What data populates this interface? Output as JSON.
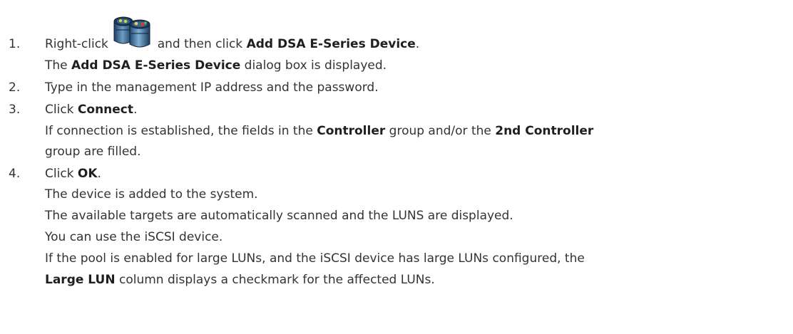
{
  "steps": [
    {
      "number": "1.",
      "lines": [
        {
          "pre": "Right-click",
          "icon": "storage-device-icon",
          "post": "and then click",
          "bold": "Add DSA E-Series Device",
          "end": "."
        },
        {
          "pre": "The",
          "bold": "Add DSA E-Series Device",
          "post": "dialog box is displayed."
        }
      ]
    },
    {
      "number": "2.",
      "lines": [
        {
          "text": "Type in the management IP address and the password."
        }
      ]
    },
    {
      "number": "3.",
      "lines": [
        {
          "pre": "Click",
          "bold": "Connect",
          "end": "."
        },
        {
          "pre": "If connection is established, the fields in the",
          "bold": "Controller",
          "mid": "group and/or the",
          "bold2": "2nd Controller"
        },
        {
          "text": "group are filled."
        }
      ]
    },
    {
      "number": "4.",
      "lines": [
        {
          "pre": "Click",
          "bold": "OK",
          "end": "."
        },
        {
          "text": "The device is added to the system."
        },
        {
          "text": "The available targets are automatically scanned and the LUNS are displayed."
        },
        {
          "text": "You can use the iSCSI device."
        },
        {
          "text": "If the pool is enabled for large LUNs, and the iSCSI device has large LUNs configured, the"
        },
        {
          "bold": "Large LUN",
          "post": "column displays a checkmark for the affected LUNs."
        }
      ]
    }
  ]
}
